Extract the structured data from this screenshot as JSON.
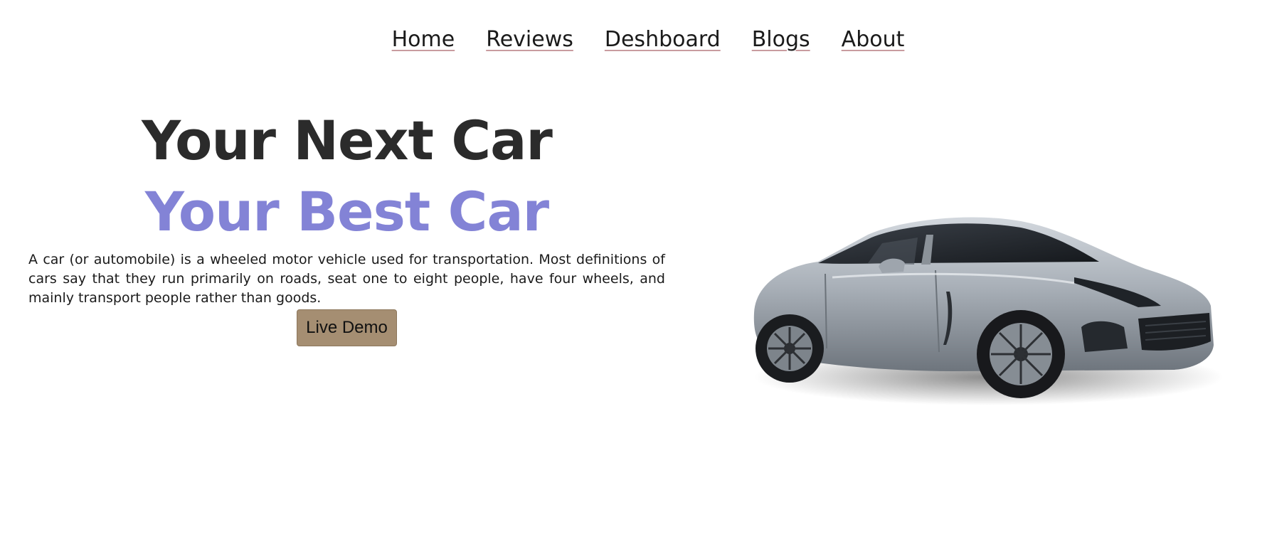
{
  "nav": {
    "items": [
      "Home",
      "Reviews",
      "Deshboard",
      "Blogs",
      "About"
    ]
  },
  "hero": {
    "title_line1": "Your Next Car",
    "title_line2": "Your Best Car",
    "description": "A car (or automobile) is a wheeled motor vehicle used for transportation. Most definitions of cars say that they run primarily on roads, seat one to eight people, have four wheels, and mainly transport people rather than goods.",
    "button_label": "Live Demo"
  },
  "colors": {
    "title_dark": "#2b2b2b",
    "title_accent": "#8383d6",
    "button_bg": "#a58e72",
    "nav_underline": "#c99ca0",
    "car_body": "#a9b0b8"
  },
  "image": {
    "car": "silver-sports-coupe-image"
  }
}
